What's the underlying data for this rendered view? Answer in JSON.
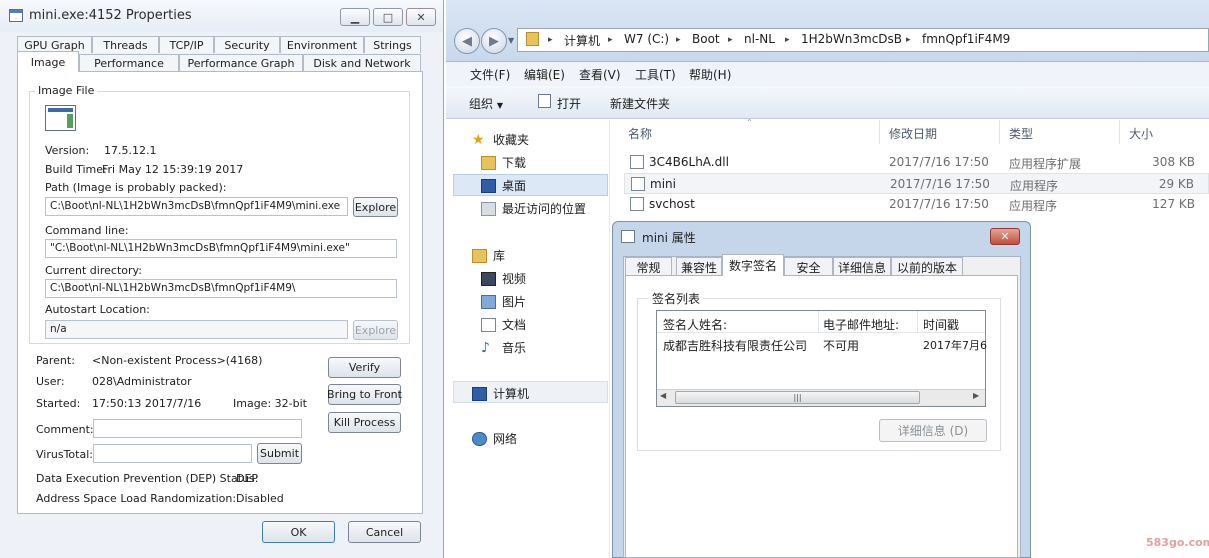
{
  "process_window": {
    "title": "mini.exe:4152 Properties",
    "tabs_row1": [
      "GPU Graph",
      "Threads",
      "TCP/IP",
      "Security",
      "Environment",
      "Strings"
    ],
    "tabs_row2": [
      "Image",
      "Performance",
      "Performance Graph",
      "Disk and Network"
    ],
    "active_tab": "Image",
    "image_file_group": "Image File",
    "version_label": "Version:",
    "version_value": "17.5.12.1",
    "build_time_label": "Build Time:",
    "build_time_value": "Fri May 12 15:39:19 2017",
    "path_label": "Path (Image is probably packed):",
    "path_value": "C:\\Boot\\nl-NL\\1H2bWn3mcDsB\\fmnQpf1iF4M9\\mini.exe",
    "explore_label": "Explore",
    "command_line_label": "Command line:",
    "command_line_value": "\"C:\\Boot\\nl-NL\\1H2bWn3mcDsB\\fmnQpf1iF4M9\\mini.exe\"",
    "current_directory_label": "Current directory:",
    "current_directory_value": "C:\\Boot\\nl-NL\\1H2bWn3mcDsB\\fmnQpf1iF4M9\\",
    "autostart_label": "Autostart Location:",
    "autostart_value": "n/a",
    "parent_label": "Parent:",
    "parent_value": "<Non-existent Process>(4168)",
    "user_label": "User:",
    "user_value": "028\\Administrator",
    "started_label": "Started:",
    "started_value": "17:50:13   2017/7/16",
    "image_bits": "Image: 32-bit",
    "comment_label": "Comment:",
    "comment_value": "",
    "virustotal_label": "VirusTotal:",
    "virustotal_value": "",
    "submit_label": "Submit",
    "verify_label": "Verify",
    "bring_to_front_label": "Bring to Front",
    "kill_process_label": "Kill Process",
    "dep_label": "Data Execution Prevention (DEP) Status:",
    "dep_value": "DEP",
    "aslr_label": "Address Space Load Randomization:",
    "aslr_value": "Disabled",
    "ok_label": "OK",
    "cancel_label": "Cancel"
  },
  "explorer": {
    "breadcrumb": [
      "计算机",
      "W7 (C:)",
      "Boot",
      "nl-NL",
      "1H2bWn3mcDsB",
      "fmnQpf1iF4M9"
    ],
    "menu": [
      "文件(F)",
      "编辑(E)",
      "查看(V)",
      "工具(T)",
      "帮助(H)"
    ],
    "toolbar": {
      "organize": "组织",
      "open": "打开",
      "new_folder": "新建文件夹"
    },
    "nav": {
      "favorites": "收藏夹",
      "downloads": "下载",
      "desktop": "桌面",
      "recent": "最近访问的位置",
      "libraries": "库",
      "videos": "视频",
      "pictures": "图片",
      "documents": "文档",
      "music": "音乐",
      "computer": "计算机",
      "network": "网络"
    },
    "columns": [
      "名称",
      "修改日期",
      "类型",
      "大小"
    ],
    "files": [
      {
        "name": "3C4B6LhA.dll",
        "date": "2017/7/16 17:50",
        "type": "应用程序扩展",
        "size": "308 KB"
      },
      {
        "name": "mini",
        "date": "2017/7/16 17:50",
        "type": "应用程序",
        "size": "29 KB"
      },
      {
        "name": "svchost",
        "date": "2017/7/16 17:50",
        "type": "应用程序",
        "size": "127 KB"
      }
    ]
  },
  "properties_dialog": {
    "title": "mini 属性",
    "tabs": [
      "常规",
      "兼容性",
      "数字签名",
      "安全",
      "详细信息",
      "以前的版本"
    ],
    "active_tab": "数字签名",
    "signature_list_label": "签名列表",
    "columns": [
      "签名人姓名:",
      "电子邮件地址:",
      "时间戳"
    ],
    "signature_rows": [
      {
        "signer": "成都吉胜科技有限责任公司",
        "email": "不可用",
        "timestamp": "2017年7月6"
      }
    ],
    "details_button": "详细信息 (D)"
  },
  "watermark": "583go.com"
}
